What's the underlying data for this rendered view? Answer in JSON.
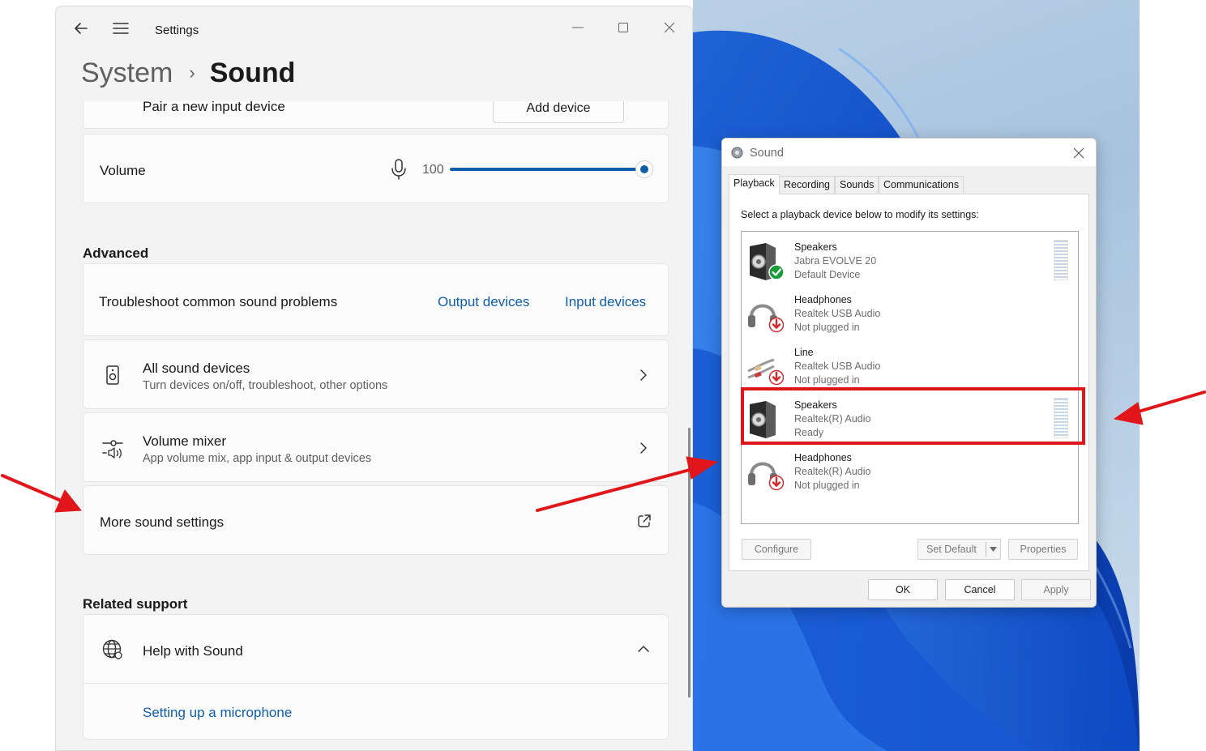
{
  "settings": {
    "title": "Settings",
    "breadcrumb": {
      "parent": "System",
      "separator": "›",
      "current": "Sound"
    },
    "pair_input": {
      "label": "Pair a new input device",
      "button": "Add device"
    },
    "volume": {
      "label": "Volume",
      "value": "100",
      "level": 1.0
    },
    "advanced": {
      "heading": "Advanced",
      "troubleshoot": {
        "label": "Troubleshoot common sound problems",
        "output_link": "Output devices",
        "input_link": "Input devices"
      },
      "all_devices": {
        "title": "All sound devices",
        "subtitle": "Turn devices on/off, troubleshoot, other options"
      },
      "volume_mixer": {
        "title": "Volume mixer",
        "subtitle": "App volume mix, app input & output devices"
      },
      "more_settings": {
        "label": "More sound settings"
      }
    },
    "related_support": {
      "heading": "Related support",
      "help": {
        "label": "Help with Sound"
      },
      "link": "Setting up a microphone"
    }
  },
  "sound_dialog": {
    "title": "Sound",
    "tabs": [
      "Playback",
      "Recording",
      "Sounds",
      "Communications"
    ],
    "active_tab": "Playback",
    "instruction": "Select a playback device below to modify its settings:",
    "devices": [
      {
        "name": "Speakers",
        "driver": "Jabra EVOLVE 20",
        "status": "Default Device",
        "icon": "speaker-icon",
        "badge": "default-check"
      },
      {
        "name": "Headphones",
        "driver": "Realtek USB Audio",
        "status": "Not plugged in",
        "icon": "headphones-icon",
        "badge": "unplugged"
      },
      {
        "name": "Line",
        "driver": "Realtek USB Audio",
        "status": "Not plugged in",
        "icon": "line-cable-icon",
        "badge": "unplugged"
      },
      {
        "name": "Speakers",
        "driver": "Realtek(R) Audio",
        "status": "Ready",
        "icon": "speaker-icon",
        "badge": "none"
      },
      {
        "name": "Headphones",
        "driver": "Realtek(R) Audio",
        "status": "Not plugged in",
        "icon": "headphones-icon",
        "badge": "unplugged"
      }
    ],
    "buttons": {
      "configure": "Configure",
      "set_default": "Set Default",
      "properties": "Properties",
      "ok": "OK",
      "cancel": "Cancel",
      "apply": "Apply"
    }
  },
  "colors": {
    "accent": "#0f5ea8",
    "annotation": "#e0161b",
    "check": "#1a9c3a",
    "unplug": "#d6262b"
  }
}
